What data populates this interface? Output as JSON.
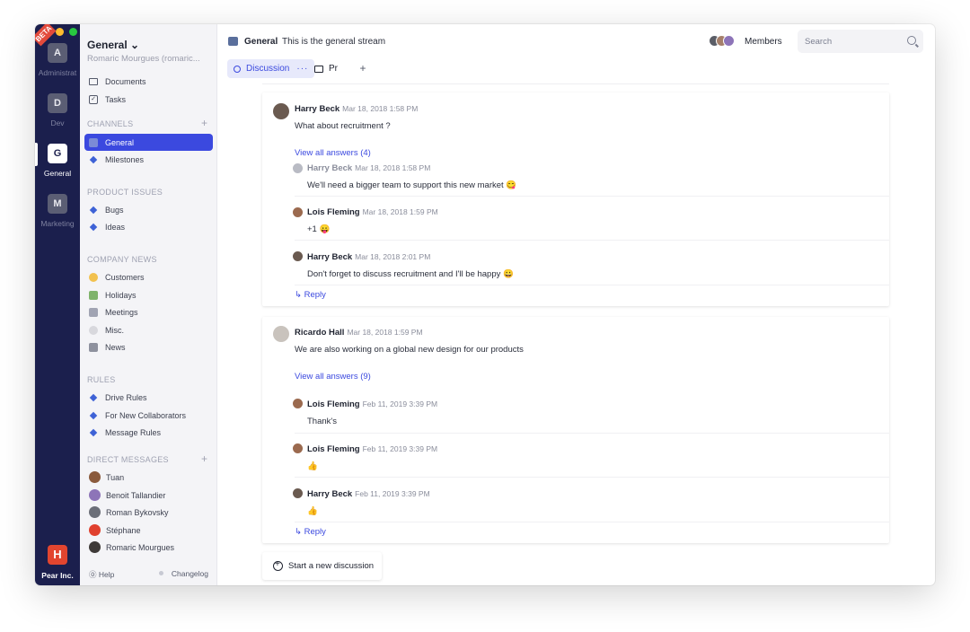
{
  "rail": {
    "beta": "BETA",
    "workspaces": [
      {
        "letter": "A",
        "name": "Administrat"
      },
      {
        "letter": "D",
        "name": "Dev"
      },
      {
        "letter": "G",
        "name": "General"
      },
      {
        "letter": "M",
        "name": "Marketing"
      }
    ],
    "org_logo": "H",
    "org_name": "Pear Inc."
  },
  "sidebar": {
    "title": "General ⌄",
    "subtitle": "Romaric Mourgues (romaric...",
    "top_items": [
      "Documents",
      "Tasks"
    ],
    "channels_title": "CHANNELS",
    "channels": [
      "General",
      "Milestones"
    ],
    "product_title": "PRODUCT ISSUES",
    "product": [
      "Bugs",
      "Ideas"
    ],
    "news_title": "COMPANY NEWS",
    "news": [
      "Customers",
      "Holidays",
      "Meetings",
      "Misc.",
      "News"
    ],
    "rules_title": "RULES",
    "rules": [
      "Drive Rules",
      "For New Collaborators",
      "Message Rules"
    ],
    "dm_title": "DIRECT MESSAGES",
    "dms": [
      "Tuan",
      "Benoit Tallandier",
      "Roman Bykovsky",
      "Stéphane",
      "Romaric Mourgues"
    ],
    "help": "⓪ Help",
    "changelog": "Changelog"
  },
  "header": {
    "channel": "General",
    "description": "This is the general stream",
    "members": "Members",
    "search_placeholder": "Search",
    "tab_discussion": "Discussion",
    "tab_more": "···",
    "tab_other": "Pr",
    "tab_add": "+"
  },
  "threads": [
    {
      "author": "Harry Beck",
      "time": "Mar 18, 2018 1:58 PM",
      "text": "What about recruitment ?",
      "view_all": "View all answers (4)",
      "replies": [
        {
          "author": "Harry Beck",
          "time": "Mar 18, 2018 1:58 PM",
          "text": "We'll need a bigger team to support this new market 😋"
        },
        {
          "author": "Lois Fleming",
          "time": "Mar 18, 2018 1:59 PM",
          "text": "+1 😛"
        },
        {
          "author": "Harry Beck",
          "time": "Mar 18, 2018 2:01 PM",
          "text": "Don't forget to discuss recruitment and I'll be happy 😀"
        }
      ],
      "reply": "↳ Reply"
    },
    {
      "author": "Ricardo Hall",
      "time": "Mar 18, 2018 1:59 PM",
      "text": "We are also working on a global new design for our products",
      "view_all": "View all answers (9)",
      "replies": [
        {
          "author": "Lois Fleming",
          "time": "Feb 11, 2019 3:39 PM",
          "text": "Thank's"
        },
        {
          "author": "Lois Fleming",
          "time": "Feb 11, 2019 3:39 PM",
          "text": "👍"
        },
        {
          "author": "Harry Beck",
          "time": "Feb 11, 2019 3:39 PM",
          "text": "👍"
        }
      ],
      "reply": "↳ Reply"
    }
  ],
  "start_discussion": "Start a new discussion",
  "colors": {
    "rail": "#1b1f4d",
    "accent": "#3b49df",
    "org": "#e2452f"
  }
}
